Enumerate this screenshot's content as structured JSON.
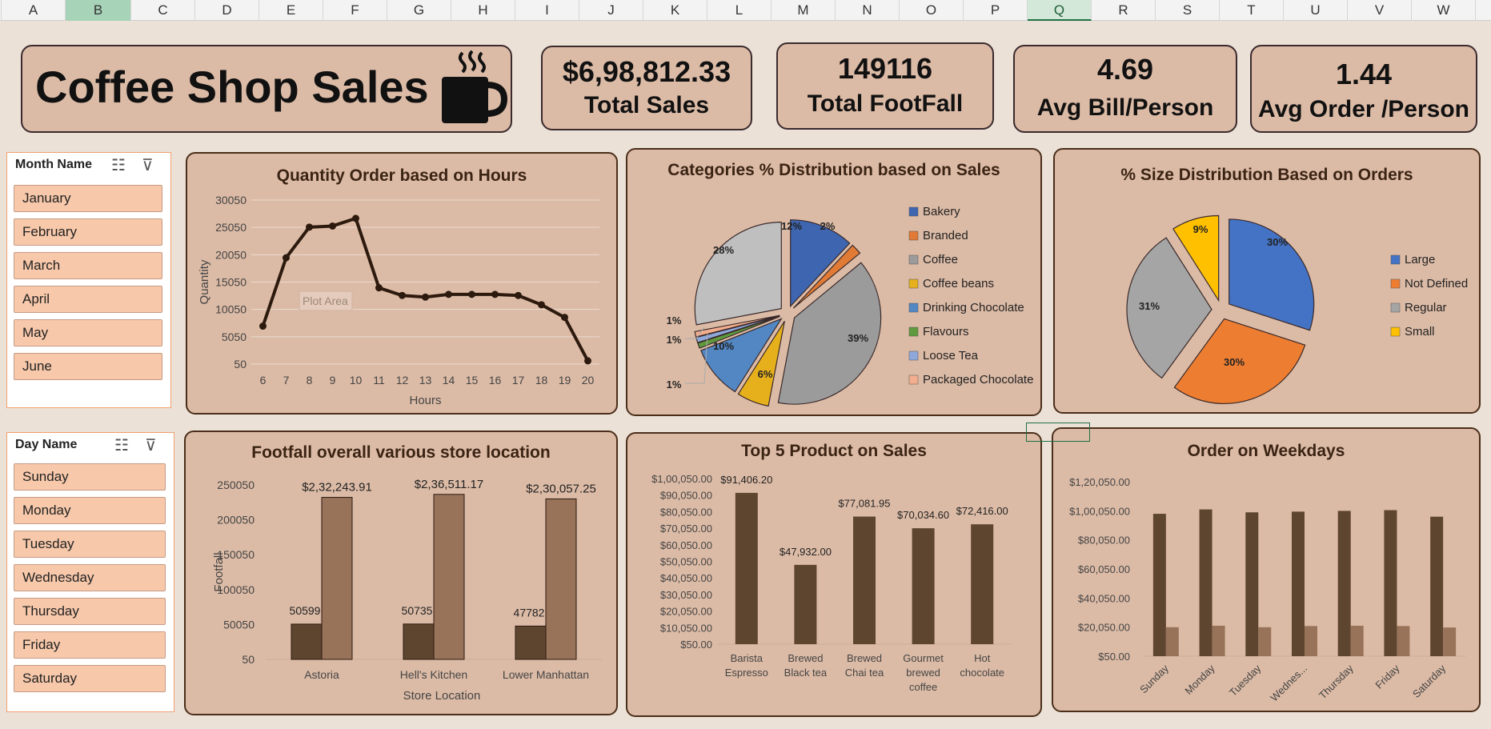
{
  "spreadsheet": {
    "columns": [
      "A",
      "B",
      "C",
      "D",
      "E",
      "F",
      "G",
      "H",
      "I",
      "J",
      "K",
      "L",
      "M",
      "N",
      "O",
      "P",
      "Q",
      "R",
      "S",
      "T",
      "U",
      "V",
      "W"
    ]
  },
  "dashboard": {
    "title": "Coffee Shop Sales",
    "kpis": [
      {
        "value": "$6,98,812.33",
        "label": "Total Sales"
      },
      {
        "value": "149116",
        "label": "Total FootFall"
      },
      {
        "value": "4.69",
        "label": "Avg Bill/Person"
      },
      {
        "value": "1.44",
        "label": "Avg Order /Person"
      }
    ],
    "plot_area_tooltip": "Plot Area"
  },
  "slicers": {
    "month": {
      "header": "Month Name",
      "items": [
        "January",
        "February",
        "March",
        "April",
        "May",
        "June"
      ]
    },
    "day": {
      "header": "Day Name",
      "items": [
        "Sunday",
        "Monday",
        "Tuesday",
        "Wednesday",
        "Thursday",
        "Friday",
        "Saturday"
      ]
    }
  },
  "colors": {
    "panel_bg": "#dcbba6",
    "dark_brown": "#5e4530",
    "light_brown": "#98735a",
    "line": "#2d1a0e",
    "slicer_item": "#f7c8aa"
  },
  "chart_data": [
    {
      "id": "hours",
      "type": "line",
      "title": "Quantity Order based on Hours",
      "xlabel": "Hours",
      "ylabel": "Quantity",
      "x": [
        6,
        7,
        8,
        9,
        10,
        11,
        12,
        13,
        14,
        15,
        16,
        17,
        18,
        19,
        20
      ],
      "values": [
        7000,
        19500,
        25100,
        25300,
        26700,
        14000,
        12600,
        12300,
        12800,
        12800,
        12800,
        12600,
        10900,
        8600,
        650
      ],
      "yticks": [
        "30050",
        "25050",
        "20050",
        "15050",
        "10050",
        "5050",
        "50"
      ],
      "ylim": [
        50,
        30050
      ]
    },
    {
      "id": "categories",
      "type": "pie",
      "title": "Categories % Distribution based on Sales",
      "labels": [
        "Bakery",
        "Branded",
        "Coffee",
        "Coffee beans",
        "Drinking Chocolate",
        "Flavours",
        "Loose Tea",
        "Packaged Chocolate"
      ],
      "values": [
        12,
        2,
        39,
        6,
        10,
        1,
        1,
        1
      ],
      "display_labels": [
        "12%",
        "2%",
        "39%",
        "6%",
        "10%",
        "1%",
        "1%",
        "1%"
      ],
      "extra_slice": {
        "label": "28%",
        "value": 28
      },
      "colors": [
        "#3e65b0",
        "#e07a35",
        "#9b9b9b",
        "#e6b01c",
        "#5287c4",
        "#5f9a3e",
        "#8ea8dc",
        "#f2ae8f",
        "#bfbfbf"
      ]
    },
    {
      "id": "size",
      "type": "pie",
      "title": "% Size Distribution Based on Orders",
      "labels": [
        "Large",
        "Not Defined",
        "Regular",
        "Small"
      ],
      "values": [
        30,
        30,
        31,
        9
      ],
      "display_labels": [
        "30%",
        "30%",
        "31%",
        "9%"
      ],
      "colors": [
        "#4472c4",
        "#ed7d31",
        "#a5a5a5",
        "#ffc000"
      ]
    },
    {
      "id": "footfall",
      "type": "bar",
      "title": "Footfall overall  various store location",
      "xlabel": "Store Location",
      "ylabel": "Footfall",
      "categories": [
        "Astoria",
        "Hell's Kitchen",
        "Lower Manhattan"
      ],
      "series": [
        {
          "values": [
            50599,
            50735,
            47782
          ],
          "labels": [
            "50599",
            "50735",
            "47782"
          ]
        },
        {
          "values": [
            232243.91,
            236511.17,
            230057.25
          ],
          "labels": [
            "$2,32,243.91",
            "$2,36,511.17",
            "$2,30,057.25"
          ]
        }
      ],
      "yticks": [
        "250050",
        "200050",
        "150050",
        "100050",
        "50050",
        "50"
      ],
      "ylim": [
        50,
        250050
      ]
    },
    {
      "id": "top5",
      "type": "bar",
      "title": "Top 5 Product on Sales",
      "categories": [
        "Barista Espresso",
        "Brewed Black tea",
        "Brewed Chai tea",
        "Gourmet brewed coffee",
        "Hot chocolate"
      ],
      "category_lines": [
        [
          "Barista",
          "Espresso"
        ],
        [
          "Brewed",
          "Black tea"
        ],
        [
          "Brewed",
          "Chai tea"
        ],
        [
          "Gourmet",
          "brewed",
          "coffee"
        ],
        [
          "Hot",
          "chocolate"
        ]
      ],
      "values": [
        91406.2,
        47932.0,
        77081.95,
        70034.6,
        72416.0
      ],
      "labels": [
        "$91,406.20",
        "$47,932.00",
        "$77,081.95",
        "$70,034.60",
        "$72,416.00"
      ],
      "yticks": [
        "$1,00,050.00",
        "$90,050.00",
        "$80,050.00",
        "$70,050.00",
        "$60,050.00",
        "$50,050.00",
        "$40,050.00",
        "$30,050.00",
        "$20,050.00",
        "$10,050.00",
        "$50.00"
      ],
      "ylim": [
        50,
        100050
      ]
    },
    {
      "id": "weekdays",
      "type": "bar",
      "title": "Order on Weekdays",
      "categories": [
        "Sunday",
        "Monday",
        "Tuesday",
        "Wednes...",
        "Thursday",
        "Friday",
        "Saturday"
      ],
      "series": [
        {
          "values": [
            98000,
            101000,
            99000,
            99500,
            100000,
            100500,
            96000
          ]
        },
        {
          "values": [
            20000,
            21000,
            20000,
            20800,
            21000,
            20800,
            19800
          ]
        }
      ],
      "yticks": [
        "$1,20,050.00",
        "$1,00,050.00",
        "$80,050.00",
        "$60,050.00",
        "$40,050.00",
        "$20,050.00",
        "$50.00"
      ],
      "ylim": [
        50,
        120050
      ]
    }
  ]
}
